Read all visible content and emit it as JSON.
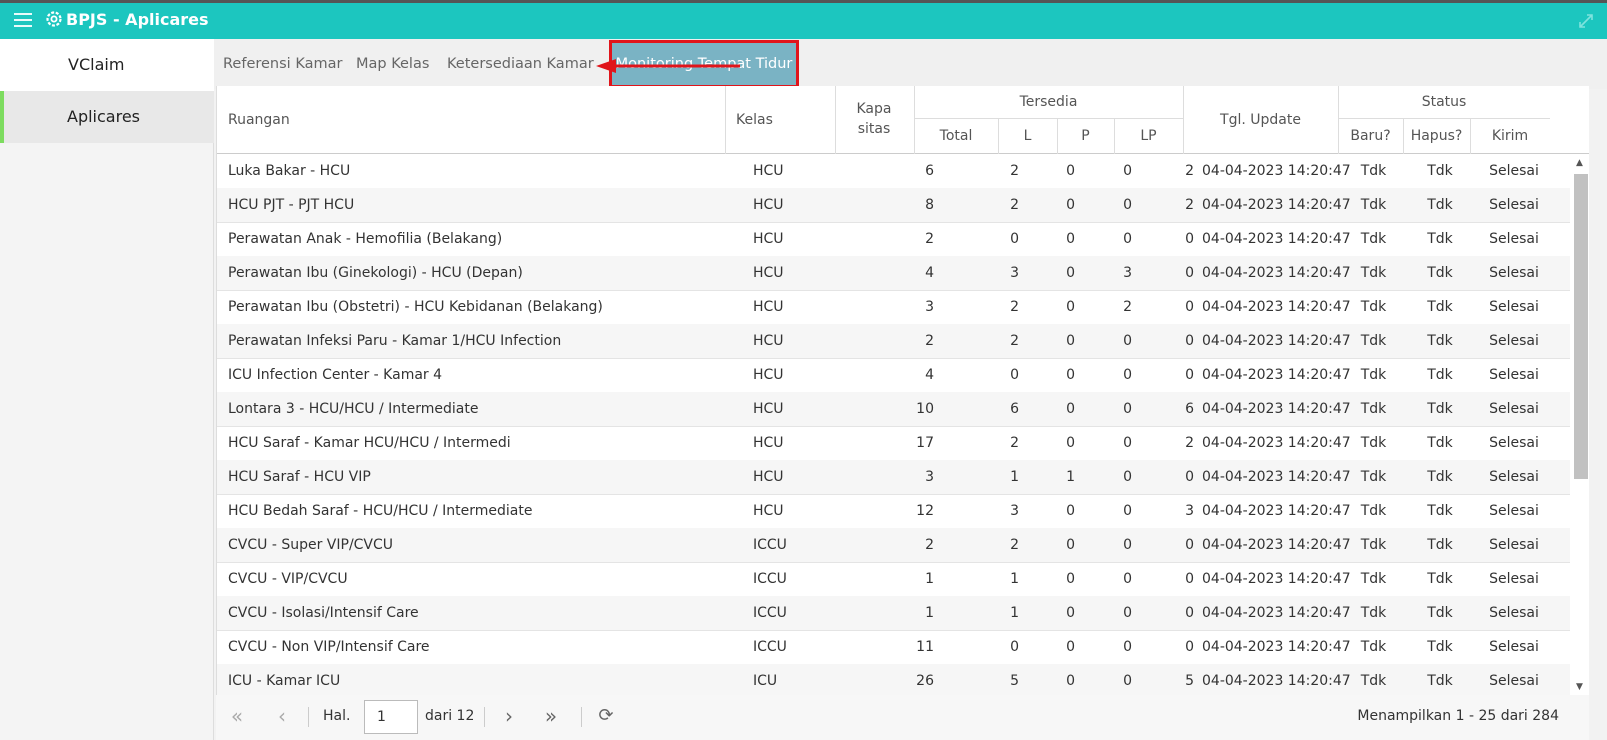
{
  "app": {
    "title": "BPJS - Aplicares"
  },
  "sidebar": {
    "items": [
      {
        "label": "VClaim"
      },
      {
        "label": "Aplicares"
      }
    ]
  },
  "tabs": [
    {
      "label": "Referensi Kamar"
    },
    {
      "label": "Map Kelas"
    },
    {
      "label": "Ketersediaan Kamar"
    },
    {
      "label": "Monitoring Tempat Tidur"
    }
  ],
  "table": {
    "headers": {
      "ruangan": "Ruangan",
      "kelas": "Kelas",
      "kapasitas_1": "Kapa",
      "kapasitas_2": "sitas",
      "tersedia": "Tersedia",
      "total": "Total",
      "l": "L",
      "p": "P",
      "lp": "LP",
      "tgl": "Tgl. Update",
      "status": "Status",
      "baru": "Baru?",
      "hapus": "Hapus?",
      "kirim": "Kirim"
    },
    "rows": [
      {
        "ruangan": "Luka Bakar - HCU",
        "kelas": "HCU",
        "kapasitas": "6",
        "total": "2",
        "l": "0",
        "p": "0",
        "lp": "2",
        "tgl": "04-04-2023 14:20:47",
        "baru": "Tdk",
        "hapus": "Tdk",
        "kirim": "Selesai"
      },
      {
        "ruangan": "HCU PJT - PJT HCU",
        "kelas": "HCU",
        "kapasitas": "8",
        "total": "2",
        "l": "0",
        "p": "0",
        "lp": "2",
        "tgl": "04-04-2023 14:20:47",
        "baru": "Tdk",
        "hapus": "Tdk",
        "kirim": "Selesai"
      },
      {
        "ruangan": "Perawatan Anak - Hemofilia (Belakang)",
        "kelas": "HCU",
        "kapasitas": "2",
        "total": "0",
        "l": "0",
        "p": "0",
        "lp": "0",
        "tgl": "04-04-2023 14:20:47",
        "baru": "Tdk",
        "hapus": "Tdk",
        "kirim": "Selesai"
      },
      {
        "ruangan": "Perawatan Ibu (Ginekologi) - HCU (Depan)",
        "kelas": "HCU",
        "kapasitas": "4",
        "total": "3",
        "l": "0",
        "p": "3",
        "lp": "0",
        "tgl": "04-04-2023 14:20:47",
        "baru": "Tdk",
        "hapus": "Tdk",
        "kirim": "Selesai"
      },
      {
        "ruangan": "Perawatan Ibu (Obstetri) - HCU Kebidanan (Belakang)",
        "kelas": "HCU",
        "kapasitas": "3",
        "total": "2",
        "l": "0",
        "p": "2",
        "lp": "0",
        "tgl": "04-04-2023 14:20:47",
        "baru": "Tdk",
        "hapus": "Tdk",
        "kirim": "Selesai"
      },
      {
        "ruangan": "Perawatan Infeksi Paru - Kamar 1/HCU Infection",
        "kelas": "HCU",
        "kapasitas": "2",
        "total": "2",
        "l": "0",
        "p": "0",
        "lp": "0",
        "tgl": "04-04-2023 14:20:47",
        "baru": "Tdk",
        "hapus": "Tdk",
        "kirim": "Selesai"
      },
      {
        "ruangan": "ICU Infection Center - Kamar 4",
        "kelas": "HCU",
        "kapasitas": "4",
        "total": "0",
        "l": "0",
        "p": "0",
        "lp": "0",
        "tgl": "04-04-2023 14:20:47",
        "baru": "Tdk",
        "hapus": "Tdk",
        "kirim": "Selesai"
      },
      {
        "ruangan": "Lontara 3 - HCU/HCU / Intermediate",
        "kelas": "HCU",
        "kapasitas": "10",
        "total": "6",
        "l": "0",
        "p": "0",
        "lp": "6",
        "tgl": "04-04-2023 14:20:47",
        "baru": "Tdk",
        "hapus": "Tdk",
        "kirim": "Selesai"
      },
      {
        "ruangan": "HCU Saraf - Kamar HCU/HCU / Intermedi",
        "kelas": "HCU",
        "kapasitas": "17",
        "total": "2",
        "l": "0",
        "p": "0",
        "lp": "2",
        "tgl": "04-04-2023 14:20:47",
        "baru": "Tdk",
        "hapus": "Tdk",
        "kirim": "Selesai"
      },
      {
        "ruangan": "HCU Saraf - HCU VIP",
        "kelas": "HCU",
        "kapasitas": "3",
        "total": "1",
        "l": "1",
        "p": "0",
        "lp": "0",
        "tgl": "04-04-2023 14:20:47",
        "baru": "Tdk",
        "hapus": "Tdk",
        "kirim": "Selesai"
      },
      {
        "ruangan": "HCU Bedah Saraf - HCU/HCU / Intermediate",
        "kelas": "HCU",
        "kapasitas": "12",
        "total": "3",
        "l": "0",
        "p": "0",
        "lp": "3",
        "tgl": "04-04-2023 14:20:47",
        "baru": "Tdk",
        "hapus": "Tdk",
        "kirim": "Selesai"
      },
      {
        "ruangan": "CVCU - Super VIP/CVCU",
        "kelas": "ICCU",
        "kapasitas": "2",
        "total": "2",
        "l": "0",
        "p": "0",
        "lp": "0",
        "tgl": "04-04-2023 14:20:47",
        "baru": "Tdk",
        "hapus": "Tdk",
        "kirim": "Selesai"
      },
      {
        "ruangan": "CVCU - VIP/CVCU",
        "kelas": "ICCU",
        "kapasitas": "1",
        "total": "1",
        "l": "0",
        "p": "0",
        "lp": "0",
        "tgl": "04-04-2023 14:20:47",
        "baru": "Tdk",
        "hapus": "Tdk",
        "kirim": "Selesai"
      },
      {
        "ruangan": "CVCU - Isolasi/Intensif Care",
        "kelas": "ICCU",
        "kapasitas": "1",
        "total": "1",
        "l": "0",
        "p": "0",
        "lp": "0",
        "tgl": "04-04-2023 14:20:47",
        "baru": "Tdk",
        "hapus": "Tdk",
        "kirim": "Selesai"
      },
      {
        "ruangan": "CVCU - Non VIP/Intensif Care",
        "kelas": "ICCU",
        "kapasitas": "11",
        "total": "0",
        "l": "0",
        "p": "0",
        "lp": "0",
        "tgl": "04-04-2023 14:20:47",
        "baru": "Tdk",
        "hapus": "Tdk",
        "kirim": "Selesai"
      },
      {
        "ruangan": "ICU - Kamar ICU",
        "kelas": "ICU",
        "kapasitas": "26",
        "total": "5",
        "l": "0",
        "p": "0",
        "lp": "5",
        "tgl": "04-04-2023 14:20:47",
        "baru": "Tdk",
        "hapus": "Tdk",
        "kirim": "Selesai"
      }
    ]
  },
  "pager": {
    "page_label": "Hal.",
    "page_value": "1",
    "page_total": "dari 12",
    "info": "Menampilkan 1 - 25 dari 284"
  },
  "colors": {
    "topbar": "#1cc6bf",
    "active_tab": "#7ab3c4",
    "highlight": "#e0151b",
    "sidebar_accent": "#7ddc5f"
  }
}
